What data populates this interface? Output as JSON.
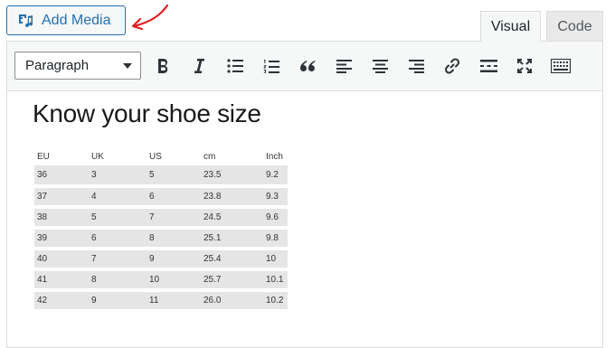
{
  "add_media": {
    "label": "Add Media",
    "icon": "media-icon"
  },
  "tabs": [
    {
      "label": "Visual",
      "active": true
    },
    {
      "label": "Code",
      "active": false
    }
  ],
  "toolbar": {
    "format_select": "Paragraph",
    "buttons": [
      "bold",
      "italic",
      "bulleted-list",
      "numbered-list",
      "blockquote",
      "align-left",
      "align-center",
      "align-right",
      "insert-link",
      "read-more",
      "fullscreen",
      "toolbar-toggle"
    ]
  },
  "content": {
    "title": "Know your shoe size",
    "table": {
      "headers": [
        "EU",
        "UK",
        "US",
        "cm",
        "Inch"
      ],
      "rows": [
        [
          "36",
          "3",
          "5",
          "23.5",
          "9.2"
        ],
        [
          "37",
          "4",
          "6",
          "23.8",
          "9.3"
        ],
        [
          "38",
          "5",
          "7",
          "24.5",
          "9.6"
        ],
        [
          "39",
          "6",
          "8",
          "25.1",
          "9.8"
        ],
        [
          "40",
          "7",
          "9",
          "25.4",
          "10"
        ],
        [
          "41",
          "8",
          "10",
          "25.7",
          "10.1"
        ],
        [
          "42",
          "9",
          "11",
          "26.0",
          "10.2"
        ]
      ]
    }
  },
  "colors": {
    "accent": "#2271b1",
    "annotation_arrow": "#e02020",
    "row_fill": "#e5e5e5"
  }
}
